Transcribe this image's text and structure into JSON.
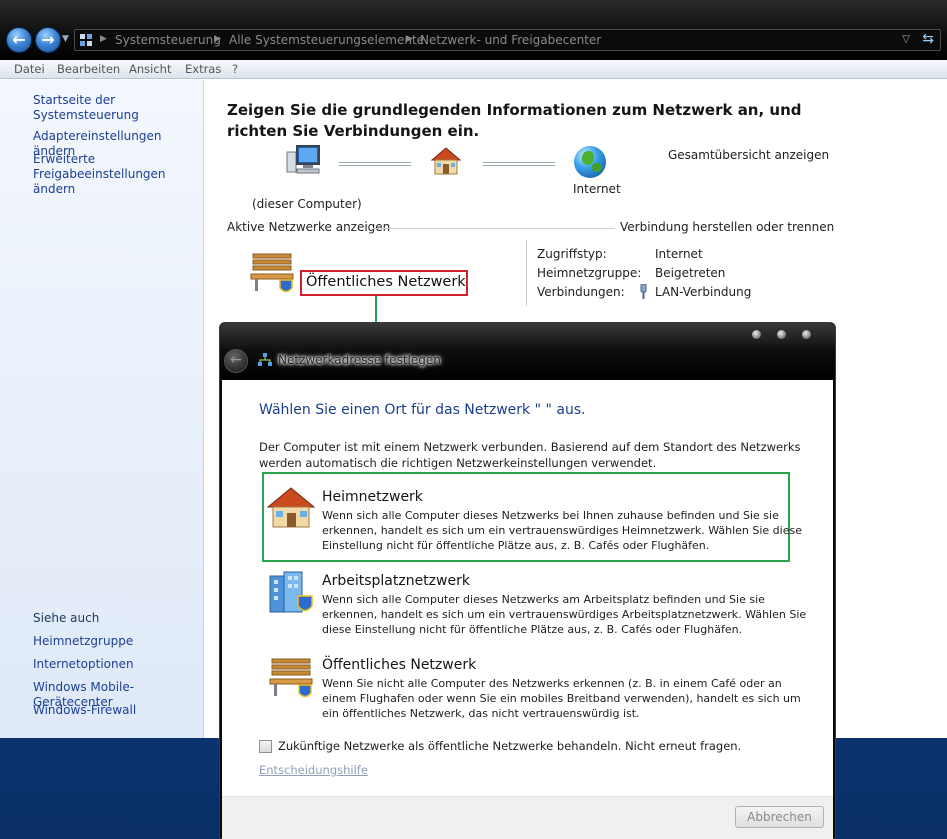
{
  "addressbar": {
    "crumbs": [
      "Systemsteuerung",
      "Alle Systemsteuerungselemente",
      "Netzwerk- und Freigabecenter"
    ]
  },
  "menu": [
    "Datei",
    "Bearbeiten",
    "Ansicht",
    "Extras",
    "?"
  ],
  "sidebar": {
    "home_link": "Startseite der Systemsteuerung",
    "adapter_link": "Adaptereinstellungen ändern",
    "sharing_link": "Erweiterte Freigabeeinstellungen ändern",
    "see_also_heading": "Siehe auch",
    "see_also": [
      "Heimnetzgruppe",
      "Internetoptionen",
      "Windows Mobile-Gerätecenter",
      "Windows-Firewall"
    ]
  },
  "main": {
    "title": "Zeigen Sie die grundlegenden Informationen zum Netzwerk an, und richten Sie Verbindungen ein.",
    "full_map_link": "Gesamtübersicht anzeigen",
    "this_computer_label": "(dieser Computer)",
    "internet_label": "Internet",
    "active_networks_label": "Aktive Netzwerke anzeigen",
    "connect_label": "Verbindung herstellen oder trennen",
    "network_name": "Öffentliches Netzwerk",
    "info": [
      {
        "key": "Zugriffstyp:",
        "value": "Internet"
      },
      {
        "key": "Heimnetzgruppe:",
        "value": "Beigetreten"
      },
      {
        "key": "Verbindungen:",
        "value": "LAN-Verbindung"
      }
    ]
  },
  "dialog": {
    "title": "Netzwerkadresse festlegen",
    "heading": "Wählen Sie einen Ort für das Netzwerk \"                \" aus.",
    "intro": "Der Computer ist mit einem Netzwerk verbunden. Basierend auf dem Standort des Netzwerks werden automatisch die richtigen Netzwerkeinstellungen verwendet.",
    "options": [
      {
        "title": "Heimnetzwerk",
        "desc": "Wenn sich alle Computer dieses Netzwerks bei Ihnen zuhause befinden und Sie sie erkennen, handelt es sich um ein vertrauenswürdiges Heimnetzwerk. Wählen Sie diese Einstellung nicht für öffentliche Plätze aus, z. B. Cafés oder Flughäfen."
      },
      {
        "title": "Arbeitsplatznetzwerk",
        "desc": "Wenn sich alle Computer dieses Netzwerks am Arbeitsplatz befinden und Sie sie erkennen, handelt es sich um ein vertrauenswürdiges Arbeitsplatznetzwerk. Wählen Sie diese Einstellung nicht für öffentliche Plätze aus, z. B. Cafés oder Flughäfen."
      },
      {
        "title": "Öffentliches Netzwerk",
        "desc": "Wenn Sie nicht alle Computer des Netzwerks erkennen (z. B. in einem Café oder an einem Flughafen oder wenn Sie ein mobiles Breitband verwenden), handelt es sich um ein öffentliches Netzwerk, das nicht vertrauenswürdig ist."
      }
    ],
    "checkbox_label": "Zukünftige Netzwerke als öffentliche Netzwerke behandeln. Nicht erneut fragen.",
    "help_link": "Entscheidungshilfe",
    "cancel_label": "Abbrechen"
  },
  "colors": {
    "link": "#1c3f94",
    "heading_blue": "#1a3e8e",
    "highlight_red": "#d0202a",
    "highlight_green": "#2aa44a"
  }
}
